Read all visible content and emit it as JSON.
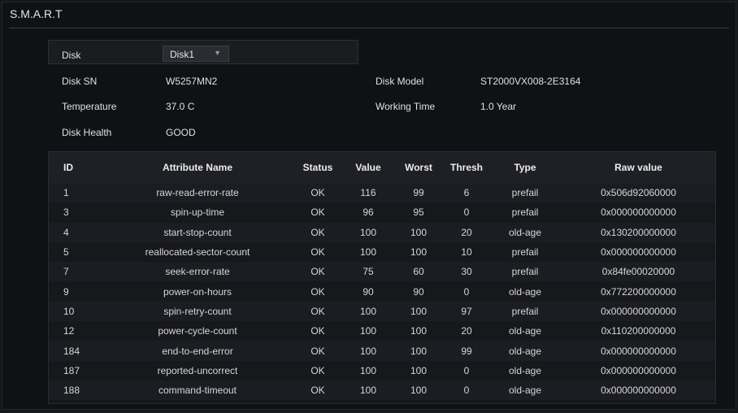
{
  "title": "S.M.A.R.T",
  "disk": {
    "label": "Disk",
    "selected": "Disk1"
  },
  "info": {
    "disk_sn_label": "Disk SN",
    "disk_sn": "W5257MN2",
    "disk_model_label": "Disk Model",
    "disk_model": "ST2000VX008-2E3164",
    "temperature_label": "Temperature",
    "temperature": "37.0 C",
    "working_time_label": "Working Time",
    "working_time": "1.0 Year",
    "disk_health_label": "Disk Health",
    "disk_health": "GOOD"
  },
  "table": {
    "headers": [
      "ID",
      "Attribute Name",
      "Status",
      "Value",
      "Worst",
      "Thresh",
      "Type",
      "Raw value"
    ],
    "rows": [
      [
        "1",
        "raw-read-error-rate",
        "OK",
        "116",
        "99",
        "6",
        "prefail",
        "0x506d92060000"
      ],
      [
        "3",
        "spin-up-time",
        "OK",
        "96",
        "95",
        "0",
        "prefail",
        "0x000000000000"
      ],
      [
        "4",
        "start-stop-count",
        "OK",
        "100",
        "100",
        "20",
        "old-age",
        "0x130200000000"
      ],
      [
        "5",
        "reallocated-sector-count",
        "OK",
        "100",
        "100",
        "10",
        "prefail",
        "0x000000000000"
      ],
      [
        "7",
        "seek-error-rate",
        "OK",
        "75",
        "60",
        "30",
        "prefail",
        "0x84fe00020000"
      ],
      [
        "9",
        "power-on-hours",
        "OK",
        "90",
        "90",
        "0",
        "old-age",
        "0x772200000000"
      ],
      [
        "10",
        "spin-retry-count",
        "OK",
        "100",
        "100",
        "97",
        "prefail",
        "0x000000000000"
      ],
      [
        "12",
        "power-cycle-count",
        "OK",
        "100",
        "100",
        "20",
        "old-age",
        "0x110200000000"
      ],
      [
        "184",
        "end-to-end-error",
        "OK",
        "100",
        "100",
        "99",
        "old-age",
        "0x000000000000"
      ],
      [
        "187",
        "reported-uncorrect",
        "OK",
        "100",
        "100",
        "0",
        "old-age",
        "0x000000000000"
      ],
      [
        "188",
        "command-timeout",
        "OK",
        "100",
        "100",
        "0",
        "old-age",
        "0x000000000000"
      ]
    ]
  },
  "colors": {
    "background": "#101114",
    "row_odd": "#1c1d22",
    "row_even": "#17181c",
    "text": "#d8d8d8"
  },
  "icons": {
    "select_arrow": "chevron-down-icon"
  }
}
